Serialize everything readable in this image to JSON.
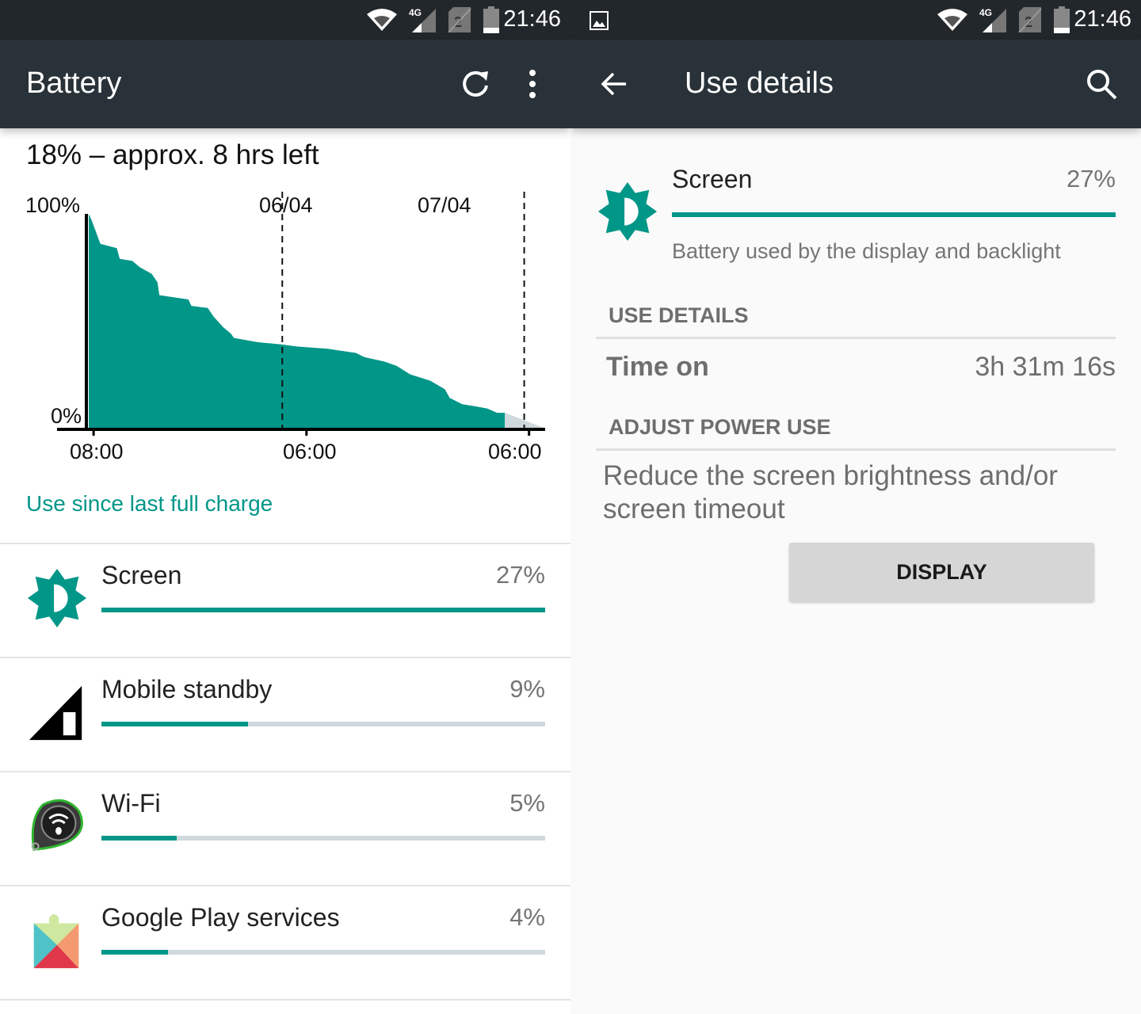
{
  "status_bar": {
    "time": "21:46",
    "network_type": "4G",
    "sim2_label": "2",
    "icons": [
      "wifi-icon",
      "signal-4g-icon",
      "sim2-no-signal-icon",
      "battery-low-icon"
    ],
    "notification_icon": "image-icon"
  },
  "battery_screen": {
    "title": "Battery",
    "actions": [
      "refresh-icon",
      "more-vert-icon"
    ],
    "estimate": "18% – approx. 8 hrs left",
    "since_label": "Use since last full charge",
    "items": [
      {
        "name": "Screen",
        "percent": "27%",
        "bar_fraction": 1.0,
        "icon": "brightness-icon"
      },
      {
        "name": "Mobile standby",
        "percent": "9%",
        "bar_fraction": 0.33,
        "icon": "cell-signal-icon"
      },
      {
        "name": "Wi-Fi",
        "percent": "5%",
        "bar_fraction": 0.17,
        "icon": "wifi-app-icon"
      },
      {
        "name": "Google Play services",
        "percent": "4%",
        "bar_fraction": 0.15,
        "icon": "play-services-icon"
      }
    ]
  },
  "chart_data": {
    "type": "area",
    "title": "",
    "y_labels": [
      "100%",
      "0%"
    ],
    "ylim": [
      0,
      100
    ],
    "x_tick_labels": [
      "08:00",
      "06:00",
      "06:00"
    ],
    "day_markers": [
      "06/04",
      "07/04"
    ],
    "x_unit": "hours since full charge",
    "xlim": [
      0,
      47
    ],
    "day_marker_x": [
      20,
      45
    ],
    "x_tick_x": [
      0.5,
      22.5,
      45.5
    ],
    "series": [
      {
        "name": "Battery level",
        "color": "#009688",
        "points": [
          [
            0,
            100
          ],
          [
            0.3,
            97
          ],
          [
            1.2,
            86
          ],
          [
            2.9,
            84
          ],
          [
            3.2,
            79
          ],
          [
            4.5,
            78
          ],
          [
            5.3,
            75
          ],
          [
            6.5,
            72
          ],
          [
            7.1,
            68
          ],
          [
            7.3,
            62
          ],
          [
            10.3,
            60
          ],
          [
            10.6,
            57
          ],
          [
            12.3,
            56
          ],
          [
            12.9,
            52
          ],
          [
            13.9,
            47
          ],
          [
            14.7,
            44
          ],
          [
            15.0,
            42
          ],
          [
            17.5,
            40
          ],
          [
            19.9,
            39
          ],
          [
            21.5,
            38
          ],
          [
            24.6,
            37
          ],
          [
            27.6,
            35
          ],
          [
            28.5,
            33
          ],
          [
            30.5,
            31
          ],
          [
            31.8,
            29
          ],
          [
            33.2,
            25
          ],
          [
            35.3,
            22
          ],
          [
            36.8,
            18
          ],
          [
            37.3,
            14
          ],
          [
            38.6,
            11
          ],
          [
            40.0,
            10
          ],
          [
            41.2,
            9
          ],
          [
            42.2,
            7
          ],
          [
            43.0,
            7
          ]
        ]
      },
      {
        "name": "Predicted",
        "color": "#cfd8dc",
        "points": [
          [
            43.0,
            7
          ],
          [
            47,
            0
          ]
        ]
      }
    ]
  },
  "details_screen": {
    "title": "Use details",
    "actions": [
      "back-arrow-icon",
      "search-icon"
    ],
    "item": {
      "name": "Screen",
      "percent": "27%",
      "description": "Battery used by the display and backlight",
      "bar_fraction": 1.0
    },
    "use_details_header": "USE DETAILS",
    "time_on_label": "Time on",
    "time_on_value": "3h 31m 16s",
    "adjust_header": "ADJUST POWER USE",
    "advice": "Reduce the screen brightness and/or screen timeout",
    "button_label": "DISPLAY"
  },
  "colors": {
    "accent": "#009688",
    "appbar": "#283238",
    "statusbar": "#22272b",
    "bar_track": "#cfd8dc"
  }
}
